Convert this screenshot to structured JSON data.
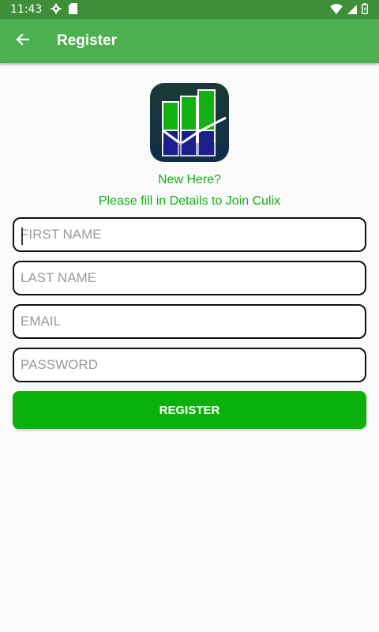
{
  "status_bar": {
    "time": "11:43",
    "left_icons": [
      "settings-icon",
      "sd-card-icon"
    ],
    "right_icons": [
      "wifi-icon",
      "signal-icon",
      "battery-icon"
    ]
  },
  "app_bar": {
    "title": "Register",
    "back_icon": "arrow-back-icon",
    "color": "#4caf50"
  },
  "logo": {
    "icon": "growth-chart-logo"
  },
  "header": {
    "line1": "New Here?",
    "line2": "Please fill in Details to Join Culix",
    "color": "#11b111"
  },
  "form": {
    "first_name": {
      "placeholder": "FIRST NAME",
      "value": ""
    },
    "last_name": {
      "placeholder": "LAST NAME",
      "value": ""
    },
    "email": {
      "placeholder": "EMAIL",
      "value": ""
    },
    "password": {
      "placeholder": "PASSWORD",
      "value": ""
    },
    "submit_label": "REGISTER",
    "submit_color": "#0ab10a"
  }
}
